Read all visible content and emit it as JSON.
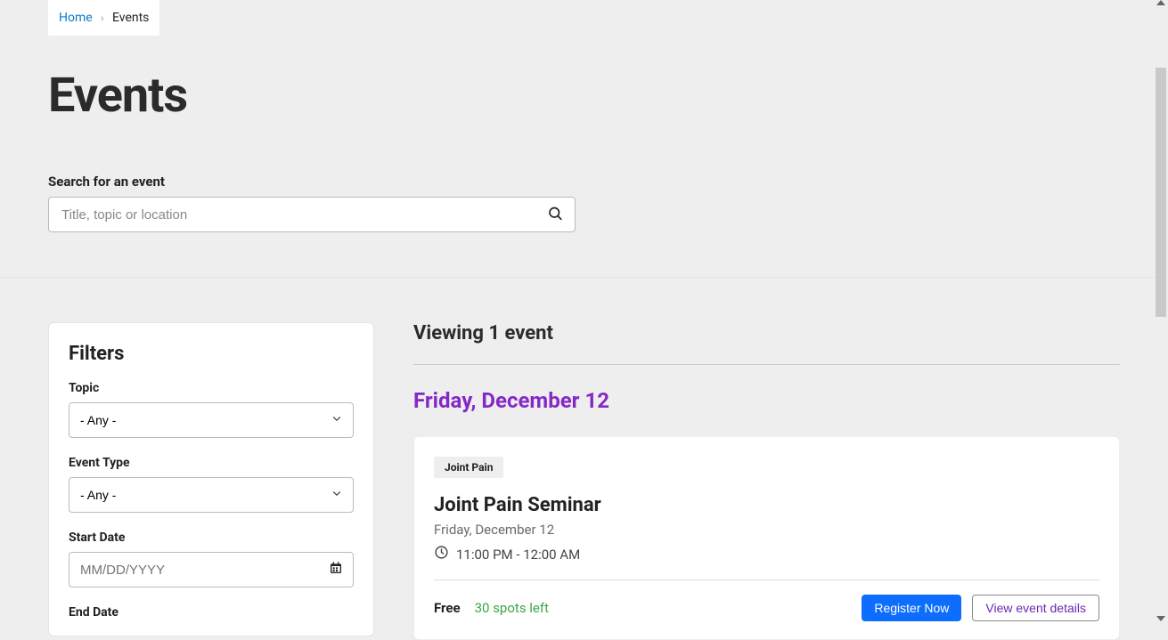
{
  "breadcrumb": {
    "home": "Home",
    "current": "Events"
  },
  "page": {
    "title": "Events"
  },
  "search": {
    "label": "Search for an event",
    "placeholder": "Title, topic or location"
  },
  "filters": {
    "heading": "Filters",
    "topic_label": "Topic",
    "topic_value": "- Any -",
    "event_type_label": "Event Type",
    "event_type_value": "- Any -",
    "start_date_label": "Start Date",
    "start_date_placeholder": "MM/DD/YYYY",
    "end_date_label": "End Date"
  },
  "results": {
    "heading": "Viewing 1 event",
    "day_heading": "Friday, December 12",
    "event": {
      "tag": "Joint Pain",
      "title": "Joint Pain Seminar",
      "date": "Friday, December 12",
      "time": "11:00 PM - 12:00 AM",
      "price": "Free",
      "spots": "30 spots left",
      "register_label": "Register Now",
      "details_label": "View event details"
    }
  }
}
